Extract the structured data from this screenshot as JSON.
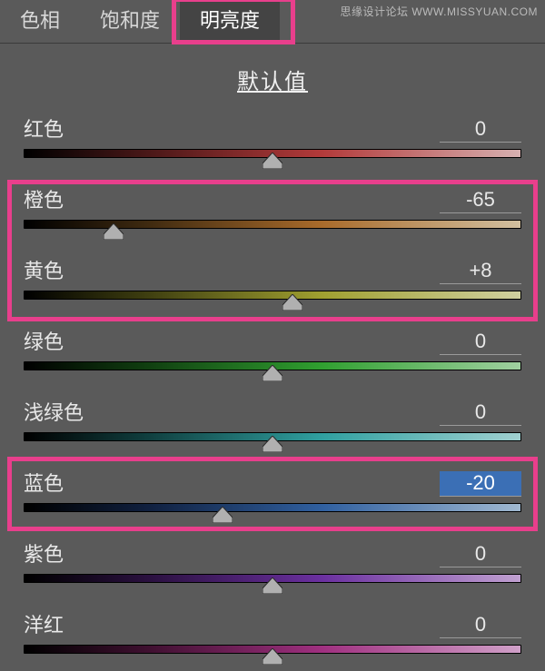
{
  "watermark": "思缘设计论坛 WWW.MISSYUAN.COM",
  "tabs": {
    "hue": "色相",
    "saturation": "饱和度",
    "luminance": "明亮度"
  },
  "active_tab": "luminance",
  "default_label": "默认值",
  "sliders": [
    {
      "key": "red",
      "label": "红色",
      "value": "0",
      "pos": 50,
      "gradient": "linear-gradient(to right,#000,#4a1818 25%,#b33a3a 60%,#d6b0b0)"
    },
    {
      "key": "orange",
      "label": "橙色",
      "value": "-65",
      "pos": 18,
      "gradient": "linear-gradient(to right,#000,#3f2a10 25%,#a96b2b 60%,#d2c0a0)"
    },
    {
      "key": "yellow",
      "label": "黄色",
      "value": "+8",
      "pos": 54,
      "gradient": "linear-gradient(to right,#000,#3f3f10 25%,#a0a030 60%,#d0d0a0)"
    },
    {
      "key": "green",
      "label": "绿色",
      "value": "0",
      "pos": 50,
      "gradient": "linear-gradient(to right,#000,#103f10 25%,#30a030 60%,#a0d0a0)"
    },
    {
      "key": "aqua",
      "label": "浅绿色",
      "value": "0",
      "pos": 50,
      "gradient": "linear-gradient(to right,#000,#103f3f 25%,#30a0a0 60%,#a0d0d0)"
    },
    {
      "key": "blue",
      "label": "蓝色",
      "value": "-20",
      "pos": 40,
      "gradient": "linear-gradient(to right,#000,#10203f 25%,#3060a0 60%,#a0b8d0)",
      "selected": true
    },
    {
      "key": "purple",
      "label": "紫色",
      "value": "0",
      "pos": 50,
      "gradient": "linear-gradient(to right,#000,#2a103f 25%,#6b30a0 60%,#c0a0d0)"
    },
    {
      "key": "magenta",
      "label": "洋红",
      "value": "0",
      "pos": 50,
      "gradient": "linear-gradient(to right,#000,#3f1030 25%,#a03080 60%,#d0a0c8)"
    }
  ]
}
